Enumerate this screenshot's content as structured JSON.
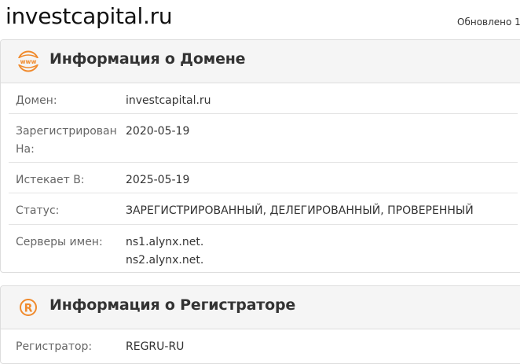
{
  "header": {
    "site_title": "investcapital.ru",
    "updated_text": "Обновлено 1"
  },
  "domain_panel": {
    "title": "Информация о Домене",
    "icon": "www-globe-icon",
    "rows": [
      {
        "label": "Домен:",
        "value": "investcapital.ru"
      },
      {
        "label": "Зарегистрирован На:",
        "value": "2020-05-19"
      },
      {
        "label": "Истекает В:",
        "value": "2025-05-19"
      },
      {
        "label": "Статус:",
        "value": "ЗАРЕГИСТРИРОВАННЫЙ, ДЕЛЕГИРОВАННЫЙ, ПРОВЕРЕННЫЙ"
      },
      {
        "label": "Серверы имен:",
        "values": [
          "ns1.alynx.net.",
          "ns2.alynx.net."
        ]
      }
    ]
  },
  "registrar_panel": {
    "title": "Информация о Регистраторе",
    "icon": "registered-trademark-icon",
    "rows": [
      {
        "label": "Регистратор:",
        "value": "REGRU-RU"
      }
    ]
  },
  "colors": {
    "accent_orange": "#f08a2c",
    "panel_header_bg": "#f5f5f5",
    "border": "#dddddd"
  }
}
